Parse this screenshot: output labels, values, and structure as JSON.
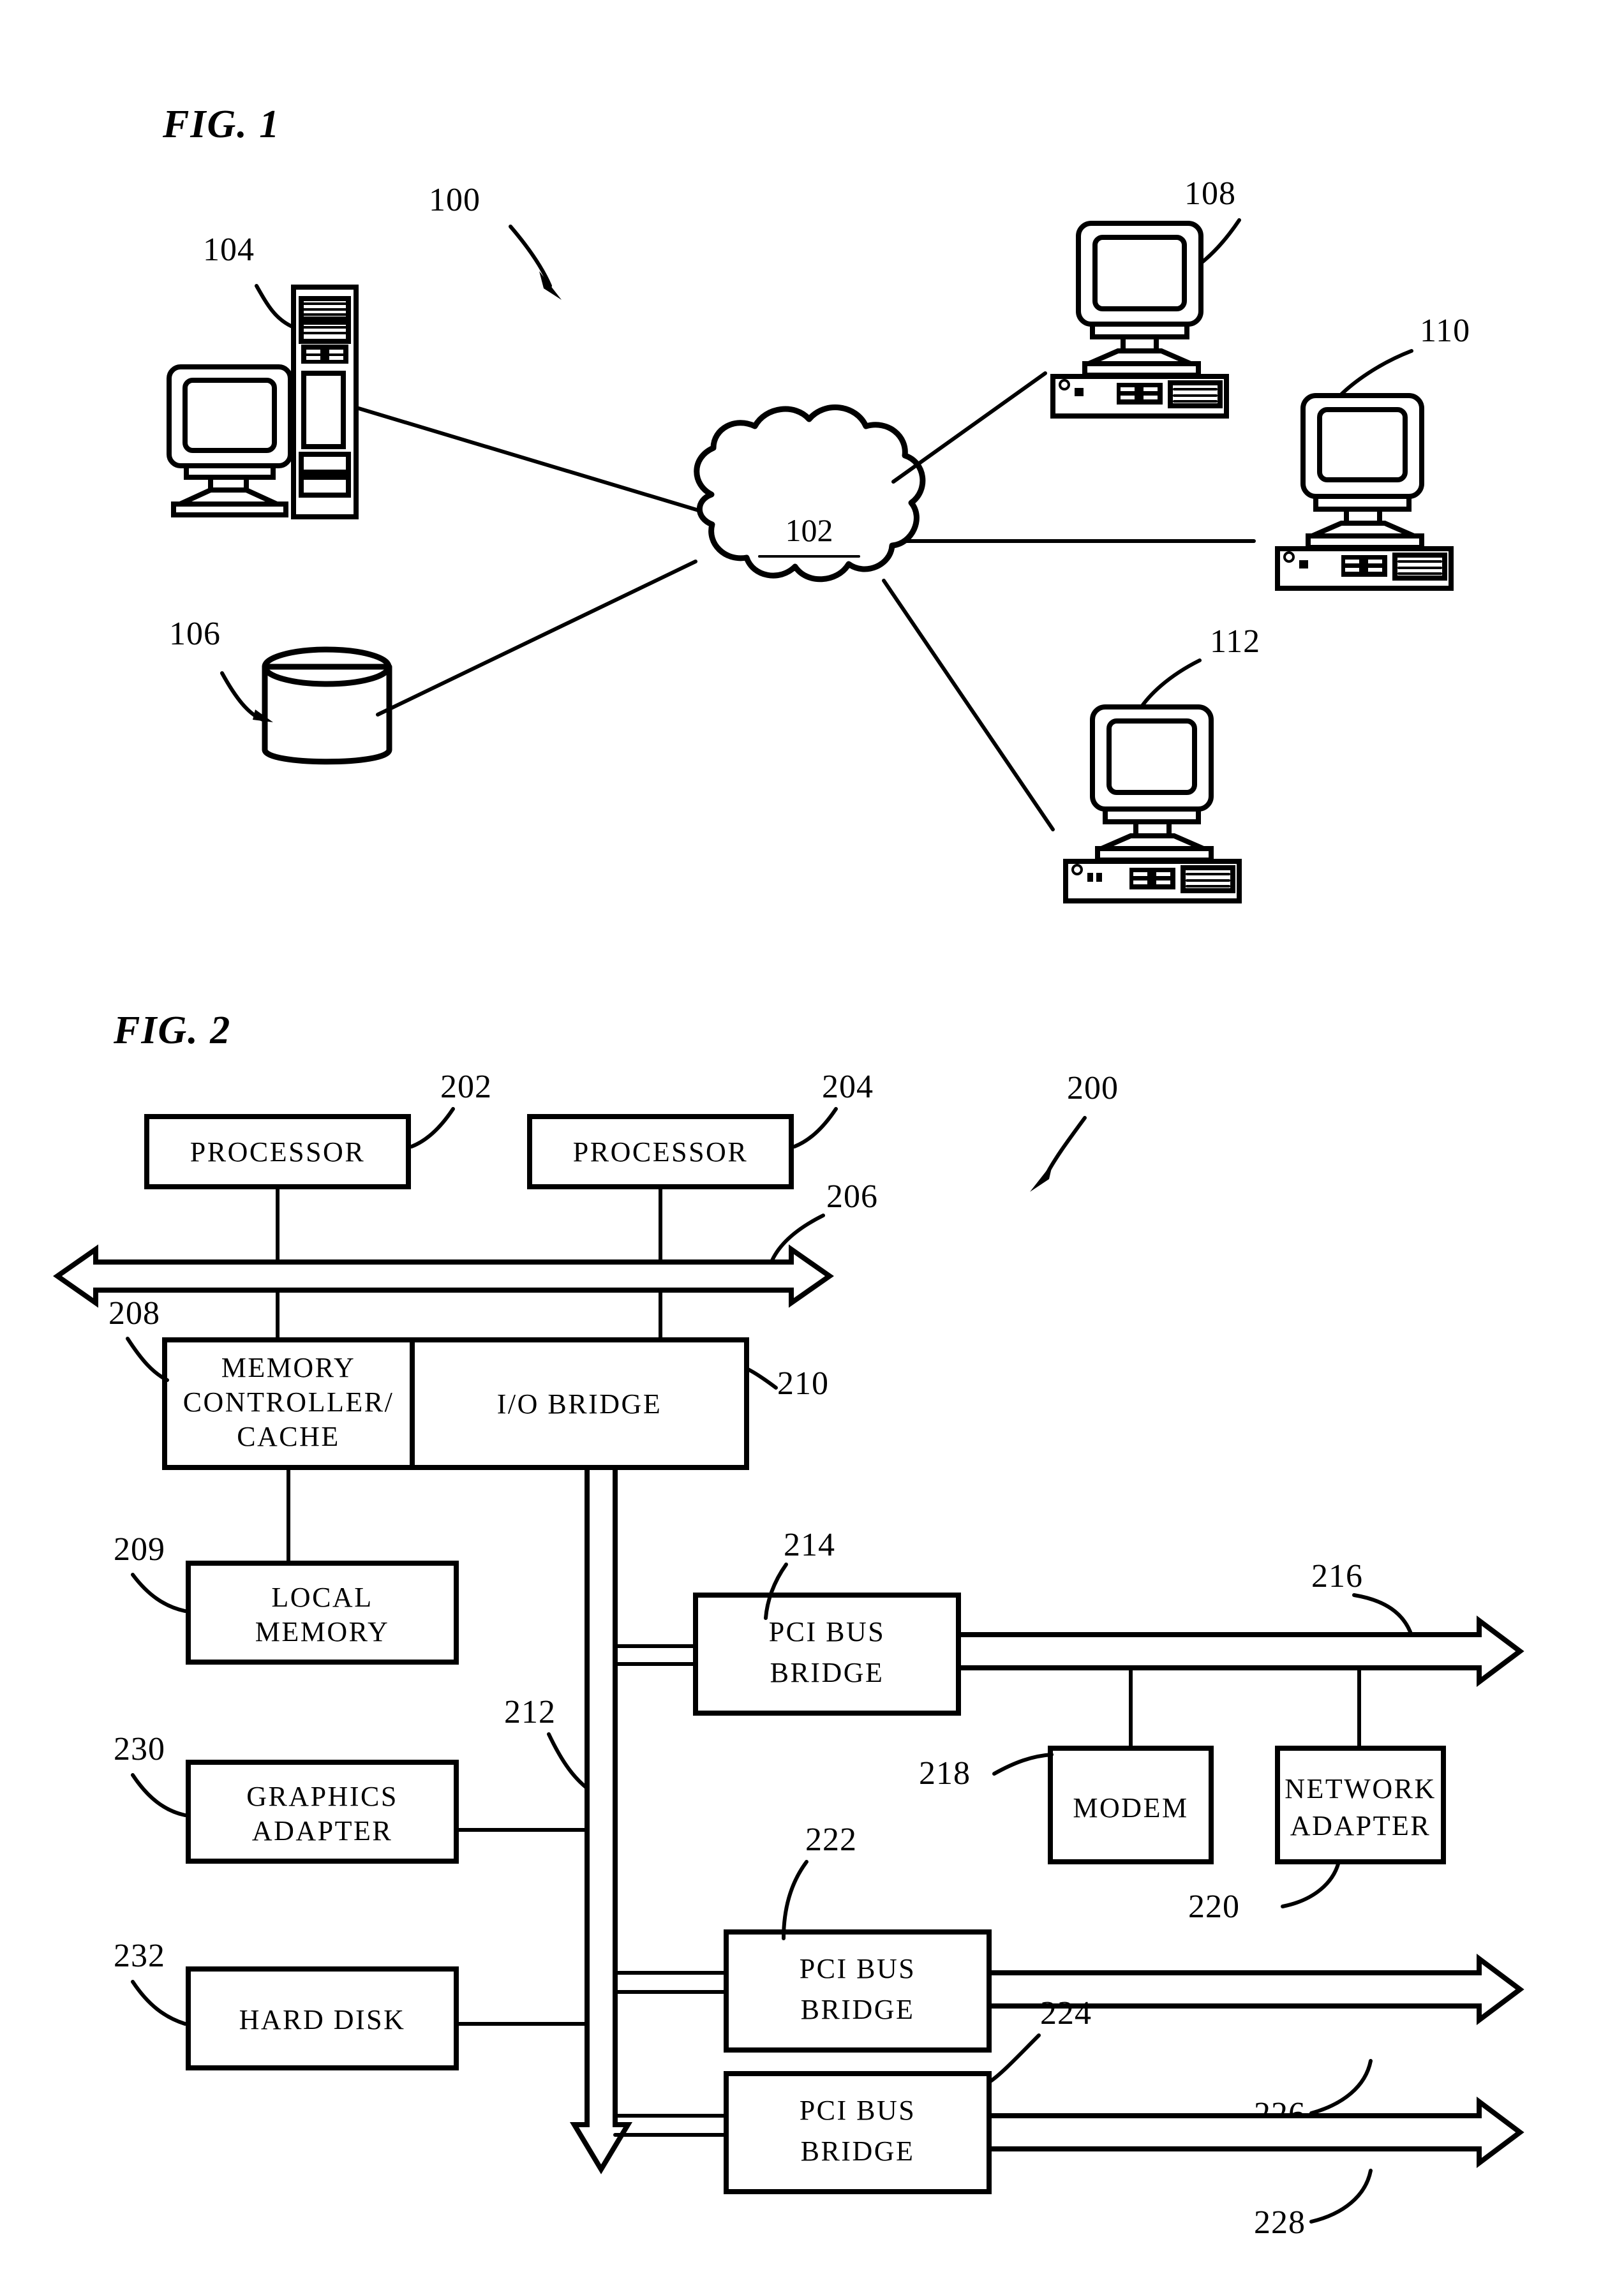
{
  "document": {
    "type": "patent-drawing-sheet",
    "figures": [
      {
        "id": "fig1",
        "title": "FIG.  1",
        "system_ref": "100",
        "network_cloud": {
          "label": "102",
          "name": "network"
        },
        "nodes": [
          {
            "ref": "104",
            "kind": "server-tower-with-monitor"
          },
          {
            "ref": "106",
            "kind": "storage-cylinder"
          },
          {
            "ref": "108",
            "kind": "desktop-computer"
          },
          {
            "ref": "110",
            "kind": "desktop-computer"
          },
          {
            "ref": "112",
            "kind": "desktop-computer"
          }
        ]
      },
      {
        "id": "fig2",
        "title": "FIG.  2",
        "system_ref": "200",
        "blocks": [
          {
            "ref": "202",
            "label": "PROCESSOR"
          },
          {
            "ref": "204",
            "label": "PROCESSOR"
          },
          {
            "ref": "208",
            "label_lines": [
              "MEMORY",
              "CONTROLLER/",
              "CACHE"
            ]
          },
          {
            "ref": "210",
            "label": "I/O  BRIDGE"
          },
          {
            "ref": "209",
            "label_lines": [
              "LOCAL",
              "MEMORY"
            ]
          },
          {
            "ref": "230",
            "label_lines": [
              "GRAPHICS",
              "ADAPTER"
            ]
          },
          {
            "ref": "232",
            "label": "HARD  DISK"
          },
          {
            "ref": "214",
            "label_lines": [
              "PCI BUS",
              "BRIDGE"
            ]
          },
          {
            "ref": "222",
            "label_lines": [
              "PCI BUS",
              "BRIDGE"
            ]
          },
          {
            "ref": "224",
            "label_lines": [
              "PCI BUS",
              "BRIDGE"
            ]
          },
          {
            "ref": "218",
            "label": "MODEM"
          },
          {
            "ref": "220",
            "label_lines": [
              "NETWORK",
              "ADAPTER"
            ]
          }
        ],
        "buses": [
          {
            "ref": "206",
            "kind": "system-bus",
            "orientation": "horizontal-double-arrow"
          },
          {
            "ref": "212",
            "kind": "io-bus",
            "orientation": "vertical-down-arrow"
          },
          {
            "ref": "216",
            "kind": "pci-local-bus",
            "orientation": "horizontal-right-arrow"
          },
          {
            "ref": "226",
            "kind": "pci-local-bus",
            "orientation": "horizontal-right-arrow"
          },
          {
            "ref": "228",
            "kind": "pci-local-bus",
            "orientation": "horizontal-right-arrow"
          }
        ]
      }
    ]
  },
  "fig1": {
    "title": "FIG.  1",
    "ref_100": "100",
    "ref_104": "104",
    "ref_106": "106",
    "ref_108": "108",
    "ref_110": "110",
    "ref_112": "112",
    "cloud_label": "102"
  },
  "fig2": {
    "title": "FIG.  2",
    "ref_200": "200",
    "ref_202": "202",
    "ref_204": "204",
    "ref_206": "206",
    "ref_208": "208",
    "ref_209": "209",
    "ref_210": "210",
    "ref_212": "212",
    "ref_214": "214",
    "ref_216": "216",
    "ref_218": "218",
    "ref_220": "220",
    "ref_222": "222",
    "ref_224": "224",
    "ref_226": "226",
    "ref_228": "228",
    "ref_230": "230",
    "ref_232": "232",
    "label_processor_1": "PROCESSOR",
    "label_processor_2": "PROCESSOR",
    "label_memctl_1": "MEMORY",
    "label_memctl_2": "CONTROLLER/",
    "label_memctl_3": "CACHE",
    "label_iobridge": "I/O  BRIDGE",
    "label_localmem_1": "LOCAL",
    "label_localmem_2": "MEMORY",
    "label_graphics_1": "GRAPHICS",
    "label_graphics_2": "ADAPTER",
    "label_harddisk": "HARD  DISK",
    "label_pci1_1": "PCI BUS",
    "label_pci1_2": "BRIDGE",
    "label_pci2_1": "PCI BUS",
    "label_pci2_2": "BRIDGE",
    "label_pci3_1": "PCI BUS",
    "label_pci3_2": "BRIDGE",
    "label_modem": "MODEM",
    "label_netadapter_1": "NETWORK",
    "label_netadapter_2": "ADAPTER"
  },
  "colors": {
    "ink": "#000000",
    "paper": "#ffffff"
  }
}
